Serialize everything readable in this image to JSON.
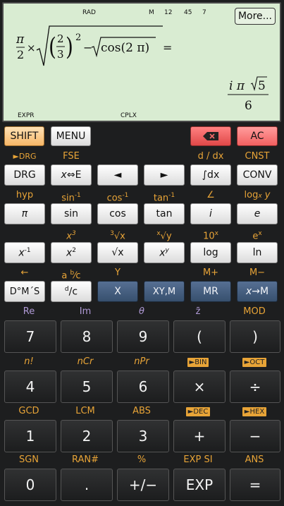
{
  "display": {
    "indicators": {
      "rad": "RAD",
      "mem": "M",
      "n12": "12",
      "n45": "45",
      "n7": "7",
      "expr": "EXPR",
      "cplx": "CPLX"
    },
    "more_label": "More...",
    "formula": {
      "pi": "π",
      "two": "2",
      "times": "×",
      "frac_num": "2",
      "frac_den": "3",
      "exponent": "2",
      "minus": "−",
      "cos_text": "cos(2 π)",
      "equals": "="
    },
    "result": {
      "i_pi": "i π",
      "five": "5",
      "six": "6"
    }
  },
  "top_row": {
    "shift": "SHIFT",
    "menu": "MENU",
    "del_icon": "backspace-icon",
    "ac": "AC"
  },
  "labels": {
    "drg_shift": "►DRG",
    "fse": "FSE",
    "d_dx": "d / dx",
    "cnst": "CNST",
    "hyp": "hyp",
    "sin_inv": "sin",
    "cos_inv": "cos",
    "tan_inv": "tan",
    "inv": "-1",
    "angle": "∠",
    "logx_log": "log",
    "logx_x": "x",
    "logx_y": " y",
    "x3_x": "x",
    "x3_e": "3",
    "cbrt_n": "3",
    "cbrt_r": "√x",
    "xrt_n": "x",
    "xrt_r": "√y",
    "ten_x_base": "10",
    "ten_x_e": "x",
    "ex_base": "e",
    "ex_e": "x",
    "arrow_left": "←",
    "ab_c_a": "a ",
    "ab_c_b": "b",
    "ab_c_c": "⁄c",
    "y_lbl": "Y",
    "m_plus": "M+",
    "m_minus": "M−",
    "re": "Re",
    "im": "Im",
    "theta": "θ",
    "zbar": "z̄",
    "mod": "MOD",
    "n_fact": "n!",
    "ncr": "nCr",
    "npr": "nPr",
    "bin": "►BIN",
    "oct": "►OCT",
    "gcd": "GCD",
    "lcm": "LCM",
    "abs": "ABS",
    "dec": "►DEC",
    "hex": "►HEX",
    "sgn": "SGN",
    "ran": "RAN#",
    "pct": "%",
    "exp_si": "EXP SI",
    "ans": "ANS"
  },
  "keys": {
    "drg": "DRG",
    "xe_x": "x",
    "xe_arrow": "⇔",
    "xe_e": "E",
    "left": "◄",
    "right": "►",
    "int_dx": "∫dx",
    "conv": "CONV",
    "pi": "π",
    "sin": "sin",
    "cos": "cos",
    "tan": "tan",
    "i": "i",
    "e": "e",
    "xinv_x": "x",
    "xinv_e": "-1",
    "xsq_x": "x",
    "xsq_e": "2",
    "sqrt": "√x",
    "xy_x": "x",
    "xy_y": "y",
    "log": "log",
    "ln": "ln",
    "dms": "D°M´S",
    "dc_d": "d",
    "dc_c": "/c",
    "x": "X",
    "xym": "XY,M",
    "mr": "MR",
    "xm_x": "x",
    "xm_arrow": "→M",
    "seven": "7",
    "eight": "8",
    "nine": "9",
    "lparen": "(",
    "rparen": ")",
    "four": "4",
    "five": "5",
    "six": "6",
    "mul": "×",
    "div": "÷",
    "one": "1",
    "two": "2",
    "three": "3",
    "plus": "+",
    "minus": "−",
    "zero": "0",
    "dot": ".",
    "sign": "+/−",
    "exp": "EXP",
    "eq": "="
  }
}
